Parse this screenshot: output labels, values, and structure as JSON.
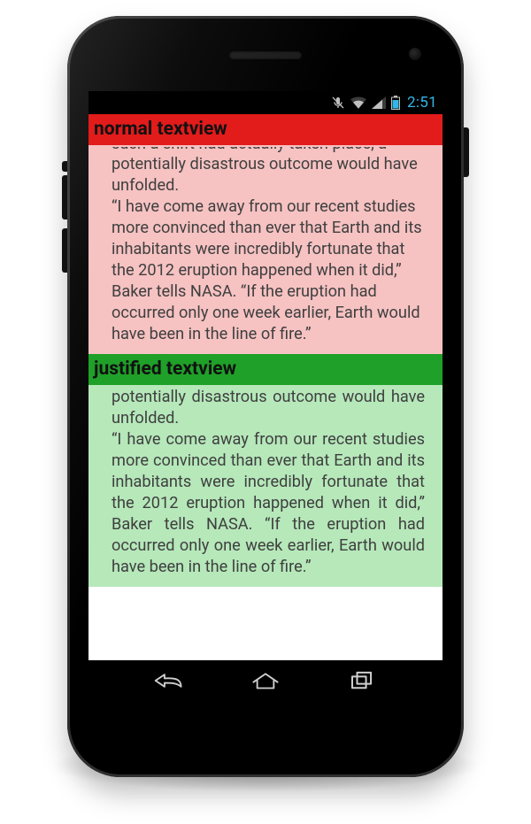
{
  "statusbar": {
    "clock": "2:51",
    "icons": {
      "mute": "microphone-muted-icon",
      "wifi": "wifi-icon",
      "signal": "cell-signal-icon",
      "battery": "battery-icon"
    }
  },
  "sections": {
    "normal": {
      "title": "normal textview",
      "clipped_top": "such a shift had actually taken place, a",
      "lead": "potentially disastrous outcome would have unfolded.",
      "quote": "“I have come away from our recent studies more convinced than ever that Earth and its inhabitants were incredibly fortunate that the 2012 eruption happened when it did,” Baker tells NASA. “If the eruption had occurred only one week earlier, Earth would have been in the line of fire.”"
    },
    "justified": {
      "title": "justified textview",
      "lead": "potentially disastrous outcome would have unfolded.",
      "quote": "“I have come away from our recent studies more convinced than ever that Earth and its inhabitants were incredibly fortunate that the 2012 eruption happened when it did,” Baker tells NASA. “If the eruption had occurred only one week earlier, Earth would have been in the line of fire.”"
    }
  },
  "navbar": {
    "back": "back-button",
    "home": "home-button",
    "recents": "recents-button"
  },
  "colors": {
    "header_red": "#e21b1b",
    "body_red": "#f6c2c2",
    "header_green": "#1fa028",
    "body_green": "#b6e8ba",
    "holo_blue": "#33b5e5"
  }
}
